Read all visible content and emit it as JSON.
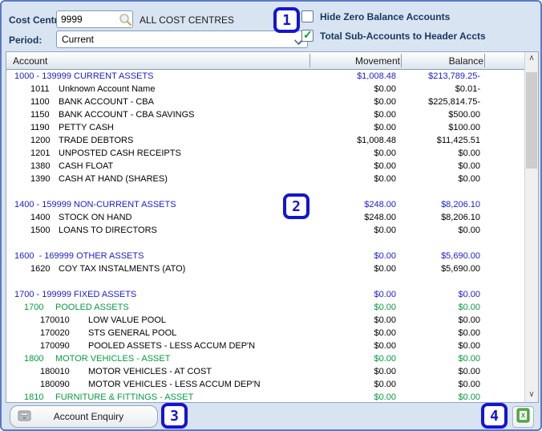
{
  "toolbar": {
    "cost_centre_label": "Cost Centre:",
    "cost_centre_value": "9999",
    "cost_centre_name": "ALL COST CENTRES",
    "period_label": "Period:",
    "period_value": "Current",
    "hide_zero_label": "Hide Zero Balance Accounts",
    "hide_zero_checked": false,
    "total_sub_label": "Total Sub-Accounts to Header Accts",
    "total_sub_checked": true,
    "check_glyph": "✓"
  },
  "table": {
    "columns": {
      "account": "Account",
      "movement": "Movement",
      "balance": "Balance"
    },
    "rows": [
      {
        "type": "section",
        "code": "",
        "name": "1000 - 139999 CURRENT ASSETS",
        "movement": "$1,008.48",
        "balance": "$213,789.25-"
      },
      {
        "type": "account",
        "code": "1011",
        "name": "Unknown Account Name",
        "movement": "$0.00",
        "balance": "$0.01-"
      },
      {
        "type": "account",
        "code": "1100",
        "name": "BANK ACCOUNT - CBA",
        "movement": "$0.00",
        "balance": "$225,814.75-"
      },
      {
        "type": "account",
        "code": "1150",
        "name": "BANK ACCOUNT - CBA SAVINGS",
        "movement": "$0.00",
        "balance": "$500.00"
      },
      {
        "type": "account",
        "code": "1190",
        "name": "PETTY CASH",
        "movement": "$0.00",
        "balance": "$100.00"
      },
      {
        "type": "account",
        "code": "1200",
        "name": "TRADE DEBTORS",
        "movement": "$1,008.48",
        "balance": "$11,425.51"
      },
      {
        "type": "account",
        "code": "1201",
        "name": "UNPOSTED CASH RECEIPTS",
        "movement": "$0.00",
        "balance": "$0.00"
      },
      {
        "type": "account",
        "code": "1380",
        "name": "CASH FLOAT",
        "movement": "$0.00",
        "balance": "$0.00"
      },
      {
        "type": "account",
        "code": "1390",
        "name": "CASH AT HAND (SHARES)",
        "movement": "$0.00",
        "balance": "$0.00"
      },
      {
        "type": "blank",
        "code": "",
        "name": "",
        "movement": "",
        "balance": ""
      },
      {
        "type": "section",
        "code": "",
        "name": "1400 - 159999 NON-CURRENT ASSETS",
        "movement": "$248.00",
        "balance": "$8,206.10"
      },
      {
        "type": "account",
        "code": "1400",
        "name": "STOCK ON HAND",
        "movement": "$248.00",
        "balance": "$8,206.10"
      },
      {
        "type": "account",
        "code": "1500",
        "name": "LOANS TO DIRECTORS",
        "movement": "$0.00",
        "balance": "$0.00"
      },
      {
        "type": "blank",
        "code": "",
        "name": "",
        "movement": "",
        "balance": ""
      },
      {
        "type": "section",
        "code": "",
        "name": "1600  - 169999 OTHER ASSETS",
        "movement": "$0.00",
        "balance": "$5,690.00"
      },
      {
        "type": "account",
        "code": "1620",
        "name": "COY TAX INSTALMENTS (ATO)",
        "movement": "$0.00",
        "balance": "$5,690.00"
      },
      {
        "type": "blank",
        "code": "",
        "name": "",
        "movement": "",
        "balance": ""
      },
      {
        "type": "section",
        "code": "",
        "name": "1700 - 199999 FIXED ASSETS",
        "movement": "$0.00",
        "balance": "$0.00"
      },
      {
        "type": "subheader",
        "code": "1700",
        "name": "POOLED ASSETS",
        "movement": "$0.00",
        "balance": "$0.00"
      },
      {
        "type": "account2",
        "code": "170010",
        "name": "LOW VALUE POOL",
        "movement": "$0.00",
        "balance": "$0.00"
      },
      {
        "type": "account2",
        "code": "170020",
        "name": "STS GENERAL POOL",
        "movement": "$0.00",
        "balance": "$0.00"
      },
      {
        "type": "account2",
        "code": "170090",
        "name": "POOLED ASSETS - LESS ACCUM DEP'N",
        "movement": "$0.00",
        "balance": "$0.00"
      },
      {
        "type": "subheader",
        "code": "1800",
        "name": "MOTOR VEHICLES - ASSET",
        "movement": "$0.00",
        "balance": "$0.00"
      },
      {
        "type": "account2",
        "code": "180010",
        "name": "MOTOR VEHICLES - AT COST",
        "movement": "$0.00",
        "balance": "$0.00"
      },
      {
        "type": "account2",
        "code": "180090",
        "name": "MOTOR VEHICLES - LESS ACCUM DEP'N",
        "movement": "$0.00",
        "balance": "$0.00"
      },
      {
        "type": "subheader",
        "code": "1810",
        "name": "FURNITURE & FITTINGS - ASSET",
        "movement": "$0.00",
        "balance": "$0.00"
      }
    ]
  },
  "footer": {
    "account_enquiry_label": "Account Enquiry"
  },
  "annotations": {
    "a1": "1",
    "a2": "2",
    "a3": "3",
    "a4": "4"
  },
  "icons": {
    "cost_centre_lookup": "magnifier-icon",
    "period_dropdown": "chevron-down-icon",
    "account_enquiry": "cash-register-icon",
    "export": "excel-export-icon",
    "scroll_up_glyph": "∧",
    "scroll_down_glyph": "∨"
  },
  "colors": {
    "section_text": "#1c1ccd",
    "subheader_text": "#089940",
    "label_text": "#17375d",
    "annotation": "#1414d2",
    "panel_bg": "#d9e4f2",
    "panel_border": "#5b79c4"
  }
}
